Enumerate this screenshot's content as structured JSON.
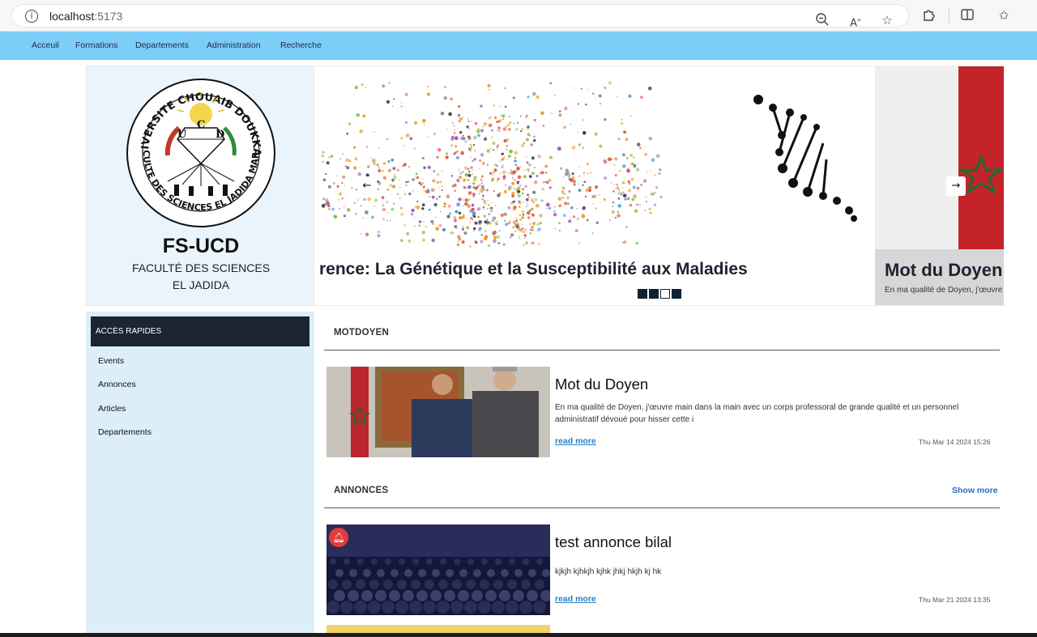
{
  "browser": {
    "url_host": "localhost",
    "url_port": ":5173",
    "icons": [
      "zoom-out-icon",
      "read-aloud-icon",
      "favorite-star-icon",
      "extensions-icon",
      "split-screen-icon",
      "favorites-icon"
    ]
  },
  "nav": {
    "items": [
      "Acceuil",
      "Formations",
      "Departements",
      "Administration",
      "Recherche"
    ]
  },
  "brand": {
    "title": "FS-UCD",
    "subtitle_line1": "FACULTÉ DES SCIENCES",
    "subtitle_line2": "EL JADIDA",
    "seal_top_text": "UNIVERSITE CHOUAIB DOUKKALI",
    "seal_bottom_text": "FACULTE DES SCIENCES EL JADIDA MAROC",
    "seal_letters": [
      "U",
      "C",
      "D"
    ]
  },
  "carousel": {
    "slide_a_caption": "rence: La Génétique et la Susceptibilité aux Maladies",
    "slide_b_title": "Mot du Doyen",
    "slide_b_text": "En ma qualité de Doyen, j'œuvre",
    "prev_label": "←",
    "next_label": "→",
    "dot_count": 4,
    "active_dot": 2
  },
  "sidebar": {
    "heading": "ACCÈS RAPIDES",
    "links": [
      "Events",
      "Annonces",
      "Articles",
      "Departements"
    ]
  },
  "motdoyen": {
    "section_title": "MOTDOYEN",
    "card": {
      "title": "Mot du Doyen",
      "text": "En ma qualité de Doyen, j'œuvre main dans la main avec un corps professoral de grande qualité et un personnel administratif dévoué pour hisser cette i",
      "read_more": "read more",
      "date": "Thu Mar 14 2024 15:26"
    }
  },
  "annonces": {
    "section_title": "ANNONCES",
    "show_more": "Show more",
    "card": {
      "title": "test annonce bilal",
      "text": "kjkjh kjhkjh kjhk jhkj hkjh kj hk",
      "read_more": "read more",
      "date": "Thu Mar 21 2024 13:35",
      "badge_icon": "bell-icon"
    }
  },
  "colors": {
    "nav_bg": "#7ccdf7",
    "sidebar_bg": "#ddeefb",
    "sidebar_head_bg": "#1c2333",
    "link_blue": "#2a7ec7"
  }
}
